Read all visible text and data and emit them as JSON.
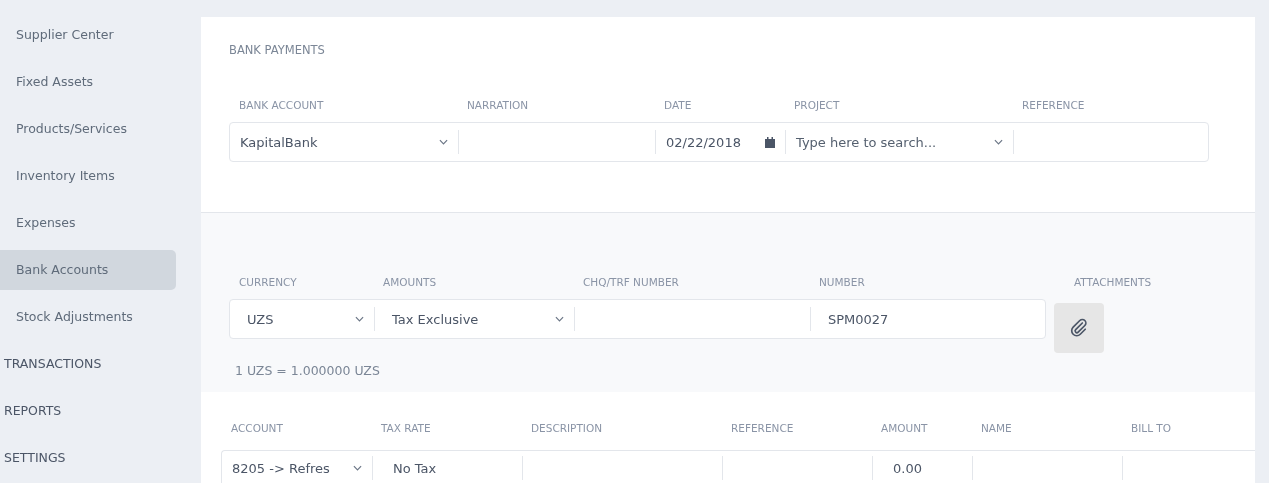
{
  "sidebar": {
    "items": [
      {
        "label": "Supplier Center",
        "selected": false
      },
      {
        "label": "Fixed Assets",
        "selected": false
      },
      {
        "label": "Products/Services",
        "selected": false
      },
      {
        "label": "Inventory Items",
        "selected": false
      },
      {
        "label": "Expenses",
        "selected": false
      },
      {
        "label": "Bank Accounts",
        "selected": true
      },
      {
        "label": "Stock Adjustments",
        "selected": false
      }
    ],
    "sections": [
      "TRANSACTIONS",
      "REPORTS",
      "SETTINGS"
    ]
  },
  "header": {
    "title": "BANK PAYMENTS",
    "fields": [
      {
        "label": "BANK ACCOUNT",
        "kind": "select",
        "value": "KapitalBank"
      },
      {
        "label": "NARRATION",
        "kind": "text"
      },
      {
        "label": "DATE",
        "kind": "date",
        "value": "02/22/2018"
      },
      {
        "label": "PROJECT",
        "kind": "select",
        "placeholder": "Type here to search..."
      },
      {
        "label": "REFERENCE",
        "kind": "text"
      }
    ]
  },
  "details": {
    "fields": [
      {
        "label": "CURRENCY",
        "kind": "select",
        "value": "UZS"
      },
      {
        "label": "AMOUNTS",
        "kind": "select",
        "value": "Tax Exclusive"
      },
      {
        "label": "CHQ/TRF NUMBER",
        "kind": "text"
      },
      {
        "label": "NUMBER",
        "kind": "text",
        "value": "SPM0027"
      }
    ],
    "attachments_label": "ATTACHMENTS",
    "rate": "1 UZS = 1.000000 UZS"
  },
  "table": {
    "columns": [
      "ACCOUNT",
      "TAX RATE",
      "DESCRIPTION",
      "REFERENCE",
      "AMOUNT",
      "NAME",
      "BILL TO"
    ],
    "rows": [
      [
        {
          "kind": "select",
          "value": "8205 -> Refres"
        },
        {
          "kind": "text",
          "value": "No Tax"
        },
        {
          "kind": "text"
        },
        {
          "kind": "text"
        },
        {
          "kind": "text",
          "value": "0.00"
        },
        {
          "kind": "text"
        },
        {
          "kind": "text"
        }
      ]
    ]
  }
}
